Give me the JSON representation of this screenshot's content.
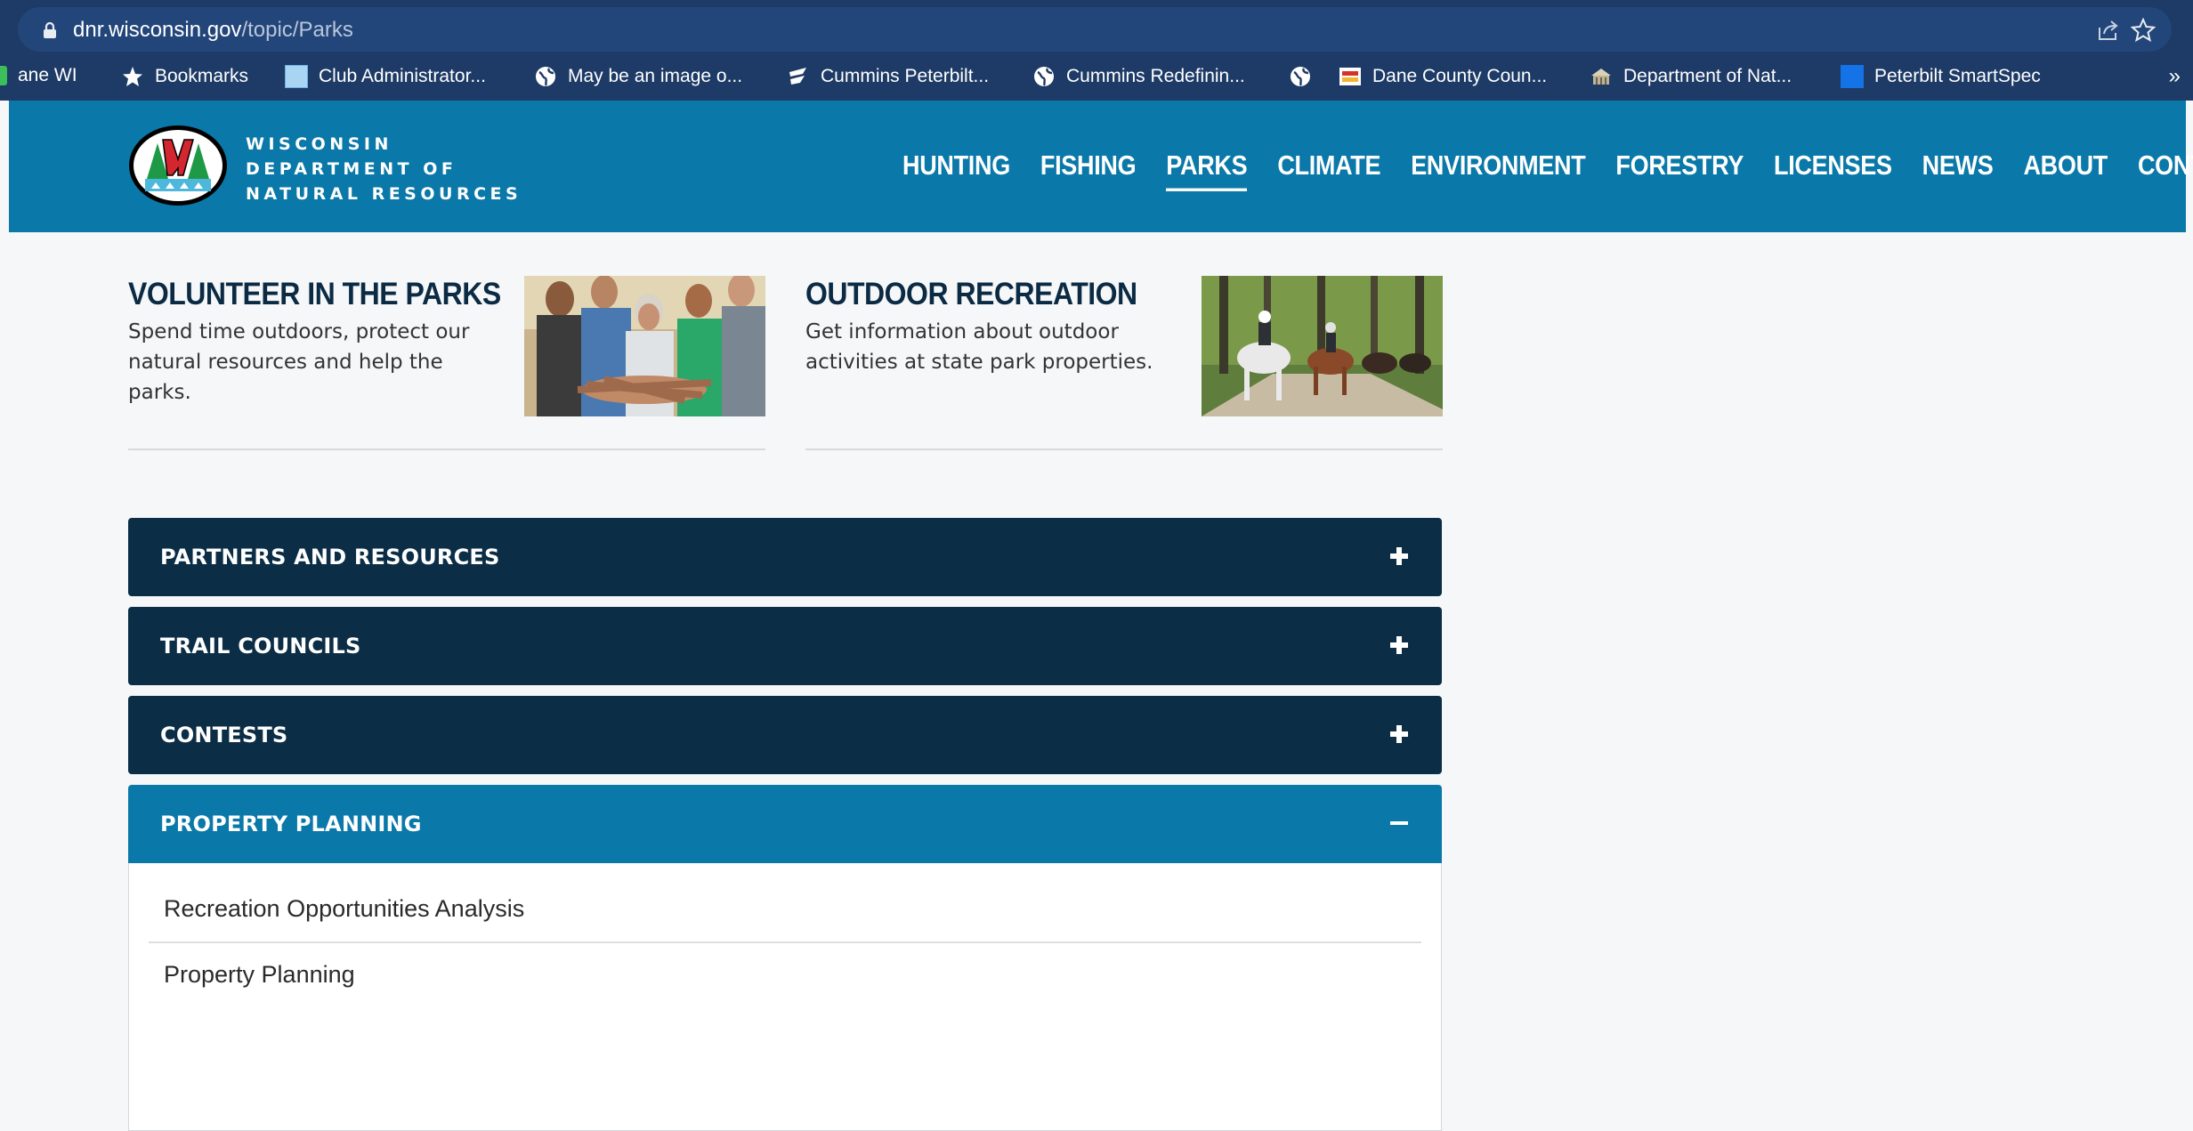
{
  "browser": {
    "url_host": "dnr.wisconsin.gov",
    "url_path": "/topic/Parks",
    "bookmarks": [
      {
        "label": "ane WI",
        "icon": "bookmark-folder-icon"
      },
      {
        "label": "Bookmarks",
        "icon": "star-icon"
      },
      {
        "label": "Club Administrator...",
        "icon": "grid-icon"
      },
      {
        "label": "May be an image o...",
        "icon": "globe-icon"
      },
      {
        "label": "Cummins Peterbilt...",
        "icon": "cummins-logo-icon"
      },
      {
        "label": "Cummins Redefinin...",
        "icon": "globe-icon"
      },
      {
        "label": "",
        "icon": "globe-icon"
      },
      {
        "label": "Dane County Coun...",
        "icon": "dane-county-logo-icon"
      },
      {
        "label": "Department of Nat...",
        "icon": "dnr-building-icon"
      },
      {
        "label": "Peterbilt SmartSpec",
        "icon": "blue-square-icon"
      }
    ],
    "more": "»"
  },
  "header": {
    "logo_lines": [
      "WISCONSIN",
      "DEPARTMENT OF",
      "NATURAL RESOURCES"
    ],
    "logo_letter": "W",
    "nav": [
      {
        "label": "HUNTING",
        "active": false
      },
      {
        "label": "FISHING",
        "active": false
      },
      {
        "label": "PARKS",
        "active": true
      },
      {
        "label": "CLIMATE",
        "active": false
      },
      {
        "label": "ENVIRONMENT",
        "active": false
      },
      {
        "label": "FORESTRY",
        "active": false
      },
      {
        "label": "LICENSES",
        "active": false
      },
      {
        "label": "NEWS",
        "active": false
      },
      {
        "label": "ABOUT",
        "active": false
      },
      {
        "label": "CONTACT",
        "active": false
      }
    ]
  },
  "cards": [
    {
      "title": "VOLUNTEER IN THE PARKS",
      "description": "Spend time outdoors, protect our natural resources and help the parks."
    },
    {
      "title": "OUTDOOR RECREATION",
      "description": "Get information about outdoor activities at state park properties."
    }
  ],
  "accordion": [
    {
      "label": "PARTNERS AND RESOURCES",
      "open": false
    },
    {
      "label": "TRAIL COUNCILS",
      "open": false
    },
    {
      "label": "CONTESTS",
      "open": false
    },
    {
      "label": "PROPERTY PLANNING",
      "open": true,
      "items": [
        "Recreation Opportunities Analysis",
        "Property Planning"
      ]
    }
  ],
  "colors": {
    "header_blue": "#0a78a8",
    "accordion_navy": "#0b2e46",
    "chrome_navy": "#1d3b66"
  }
}
